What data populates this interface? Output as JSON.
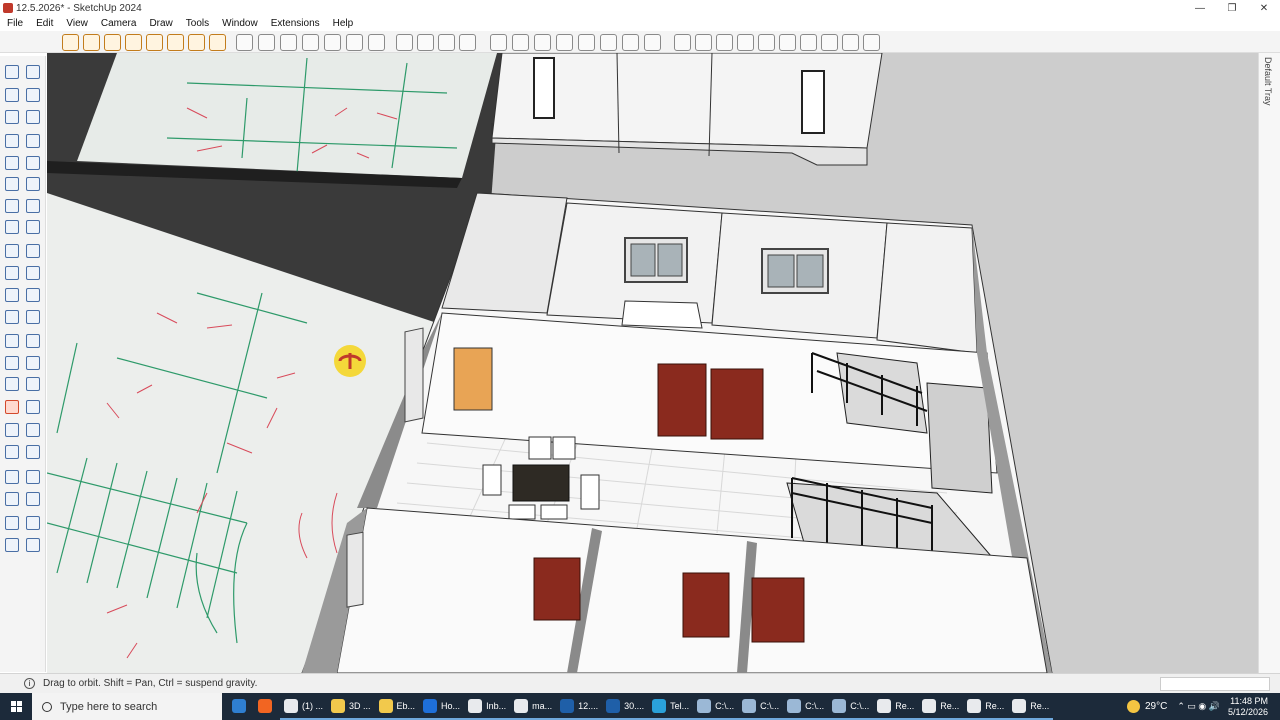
{
  "window": {
    "title": "12.5.2026* - SketchUp 2024",
    "controls": {
      "minimize": "—",
      "restore": "❐",
      "close": "✕"
    }
  },
  "menu": [
    "File",
    "Edit",
    "View",
    "Camera",
    "Draw",
    "Tools",
    "Window",
    "Extensions",
    "Help"
  ],
  "right_tray": {
    "label": "Default Tray"
  },
  "status": {
    "text": "Drag to orbit. Shift = Pan, Ctrl = suspend gravity."
  },
  "taskbar": {
    "search_placeholder": "Type here to search",
    "tasks": [
      {
        "label": "",
        "color": "#2f7fd1"
      },
      {
        "label": "",
        "color": "#f26522"
      },
      {
        "label": "(1) ...",
        "color": "#e8eaed"
      },
      {
        "label": "3D ...",
        "color": "#f2c94c"
      },
      {
        "label": "Eb...",
        "color": "#f2c94c"
      },
      {
        "label": "Ho...",
        "color": "#1e6fd9"
      },
      {
        "label": "Inb...",
        "color": "#e8eaed"
      },
      {
        "label": "ma...",
        "color": "#e8eaed"
      },
      {
        "label": "12....",
        "color": "#1f5fa8"
      },
      {
        "label": "30....",
        "color": "#1f5fa8"
      },
      {
        "label": "Tel...",
        "color": "#2aa1da"
      },
      {
        "label": "C:\\...",
        "color": "#9bb8d6"
      },
      {
        "label": "C:\\...",
        "color": "#9bb8d6"
      },
      {
        "label": "C:\\...",
        "color": "#9bb8d6"
      },
      {
        "label": "C:\\...",
        "color": "#9bb8d6"
      },
      {
        "label": "Re...",
        "color": "#e8eaed"
      },
      {
        "label": "Re...",
        "color": "#e8eaed"
      },
      {
        "label": "Re...",
        "color": "#e8eaed"
      },
      {
        "label": "Re...",
        "color": "#e8eaed"
      }
    ],
    "weather": "29°C",
    "time": "11:48 PM",
    "date": "5/12/2026"
  },
  "colors": {
    "accent": "#c27c1c",
    "tool_blue": "#4a6fa5",
    "active_tool": "#d3492c",
    "taskbar": "#1c2a3a",
    "door": "#8a2a1e",
    "orbit_cursor": "#f6d31b"
  },
  "icons": {
    "orbit_cursor": "orbit-cursor-icon",
    "search": "search-icon",
    "start": "windows-start-icon"
  }
}
